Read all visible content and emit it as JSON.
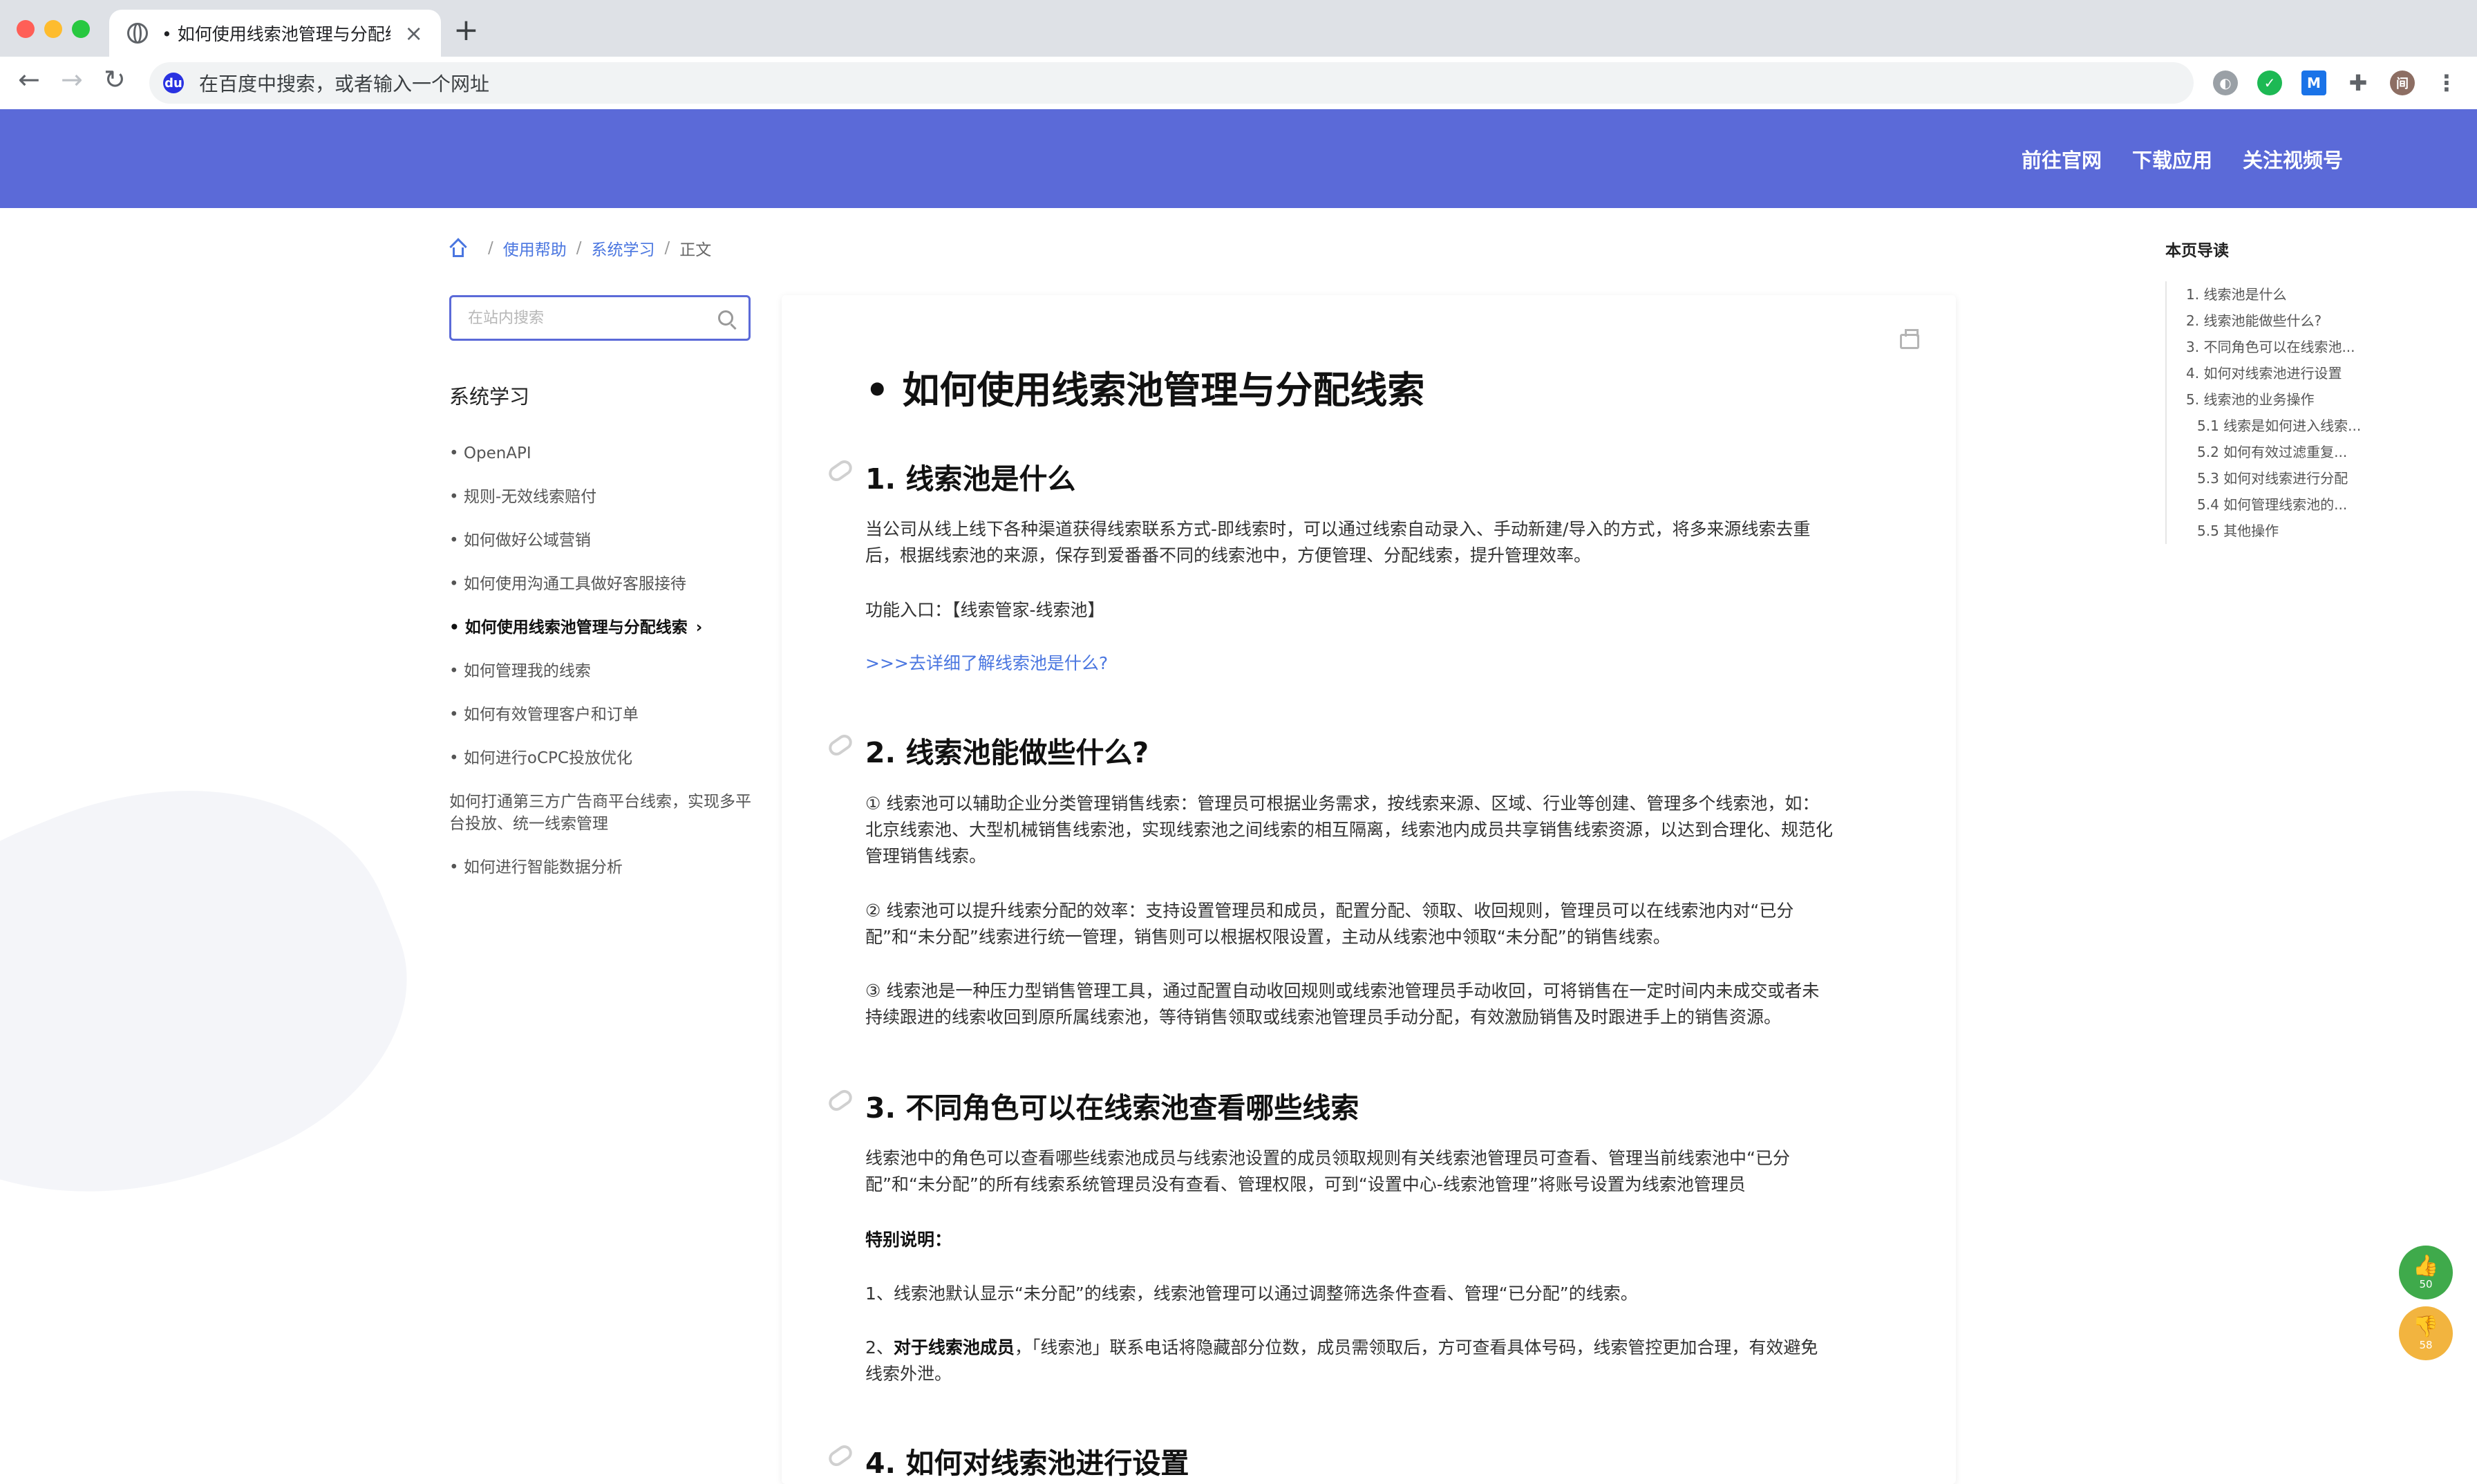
{
  "browser": {
    "tab_title": "• 如何使用线索池管理与分配线索",
    "address_placeholder": "在百度中搜索，或者输入一个网址",
    "profile_initial": "间"
  },
  "header": {
    "nav": [
      "前往官网",
      "下载应用",
      "关注视频号"
    ],
    "bg_color": "#5b6ad8"
  },
  "breadcrumb": {
    "items": [
      "使用帮助",
      "系统学习",
      "正文"
    ]
  },
  "sidebar": {
    "search_placeholder": "在站内搜索",
    "title": "系统学习",
    "items": [
      "• OpenAPI",
      "• 规则-无效线索赔付",
      "• 如何做好公域营销",
      "• 如何使用沟通工具做好客服接待",
      "• 如何使用线索池管理与分配线索",
      "• 如何管理我的线索",
      "• 如何有效管理客户和订单",
      "• 如何进行oCPC投放优化",
      "如何打通第三方广告商平台线索，实现多平台投放、统一线索管理",
      "• 如何进行智能数据分析"
    ],
    "active_index": 4
  },
  "article": {
    "title": "• 如何使用线索池管理与分配线索",
    "sections": [
      {
        "heading": "1. 线索池是什么",
        "paragraphs": [
          "当公司从线上线下各种渠道获得线索联系方式-即线索时，可以通过线索自动录入、手动新建/导入的方式，将多来源线索去重后，根据线索池的来源，保存到爱番番不同的线索池中，方便管理、分配线索，提升管理效率。",
          "功能入口：【线索管家-线索池】"
        ],
        "link": ">>>去详细了解线索池是什么?"
      },
      {
        "heading": "2. 线索池能做些什么?",
        "paragraphs": [
          "① 线索池可以辅助企业分类管理销售线索：管理员可根据业务需求，按线索来源、区域、行业等创建、管理多个线索池，如：北京线索池、大型机械销售线索池，实现线索池之间线索的相互隔离，线索池内成员共享销售线索资源，以达到合理化、规范化管理销售线索。",
          "② 线索池可以提升线索分配的效率：支持设置管理员和成员，配置分配、领取、收回规则，管理员可以在线索池内对“已分配”和“未分配”线索进行统一管理，销售则可以根据权限设置，主动从线索池中领取“未分配”的销售线索。",
          "③ 线索池是一种压力型销售管理工具，通过配置自动收回规则或线索池管理员手动收回，可将销售在一定时间内未成交或者未持续跟进的线索收回到原所属线索池，等待销售领取或线索池管理员手动分配，有效激励销售及时跟进手上的销售资源。"
        ]
      },
      {
        "heading": "3. 不同角色可以在线索池查看哪些线索",
        "paragraphs": [
          "线索池中的角色可以查看哪些线索池成员与线索池设置的成员领取规则有关线索池管理员可查看、管理当前线索池中“已分配”和“未分配”的所有线索系统管理员没有查看、管理权限，可到“设置中心-线索池管理”将账号设置为线索池管理员",
          "特别说明：",
          "1、线索池默认显示“未分配”的线索，线索池管理可以通过调整筛选条件查看、管理“已分配”的线索。"
        ],
        "note2_prefix": "2、",
        "note2_bold": "对于线索池成员",
        "note2_rest": "，「线索池」联系电话将隐藏部分位数，成员需领取后，方可查看具体号码，线索管控更加合理，有效避免线索外泄。"
      },
      {
        "heading": "4. 如何对线索池进行设置"
      }
    ]
  },
  "toc": {
    "title": "本页导读",
    "items": [
      "1. 线索池是什么",
      "2. 线索池能做些什么?",
      "3. 不同角色可以在线索池...",
      "4. 如何对线索池进行设置",
      "5. 线索池的业务操作",
      "5.1 线索是如何进入线索...",
      "5.2 如何有效过滤重复...",
      "5.3 如何对线索进行分配",
      "5.4 如何管理线索池的...",
      "5.5 其他操作"
    ]
  },
  "votes": {
    "up_count": "50",
    "down_count": "58",
    "up_color": "#3faa4b",
    "down_color": "#f2b43f"
  }
}
